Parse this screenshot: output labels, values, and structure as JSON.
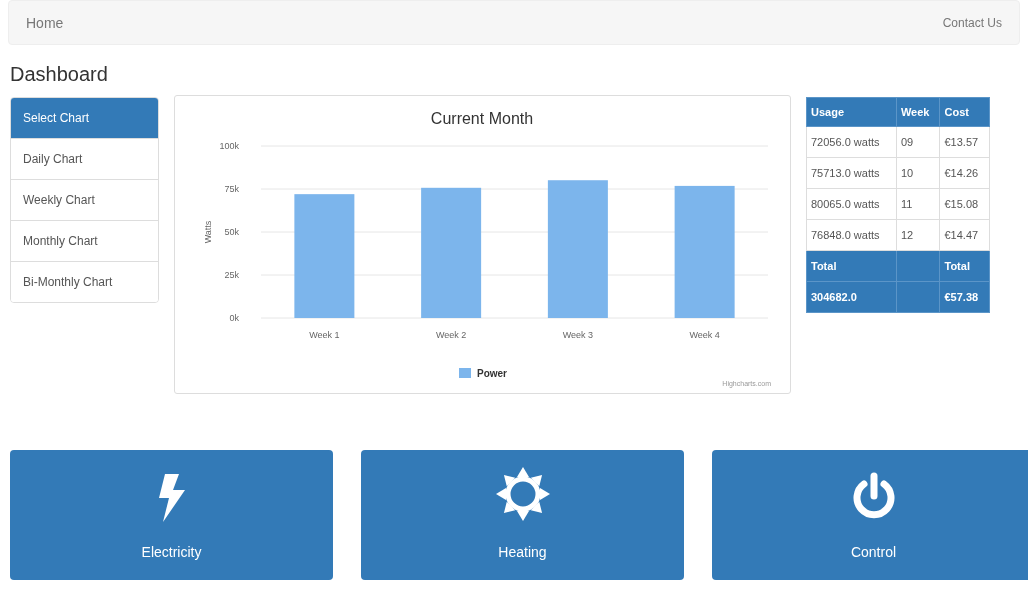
{
  "navbar": {
    "brand": "Home",
    "link": "Contact Us"
  },
  "page_title": "Dashboard",
  "sidebar": {
    "items": [
      {
        "label": "Select Chart",
        "selected": true
      },
      {
        "label": "Daily Chart",
        "selected": false
      },
      {
        "label": "Weekly Chart",
        "selected": false
      },
      {
        "label": "Monthly Chart",
        "selected": false
      },
      {
        "label": "Bi-Monthly Chart",
        "selected": false
      }
    ]
  },
  "chart": {
    "credits": "Highcharts.com",
    "chart_data": {
      "type": "bar",
      "title": "Current Month",
      "ylabel": "Watts",
      "categories": [
        "Week 1",
        "Week 2",
        "Week 3",
        "Week 4"
      ],
      "series": [
        {
          "name": "Power",
          "color": "#7cb5ec",
          "values": [
            72000,
            75700,
            80100,
            76800
          ]
        }
      ],
      "grid": true,
      "ylim": [
        0,
        100000
      ],
      "yticks": [
        {
          "value": 0,
          "label": "0k"
        },
        {
          "value": 25000,
          "label": "25k"
        },
        {
          "value": 50000,
          "label": "50k"
        },
        {
          "value": 75000,
          "label": "75k"
        },
        {
          "value": 100000,
          "label": "100k"
        }
      ]
    }
  },
  "table": {
    "columns": [
      "Usage",
      "Week",
      "Cost"
    ],
    "rows": [
      [
        "72056.0 watts",
        "09",
        "€13.57"
      ],
      [
        "75713.0 watts",
        "10",
        "€14.26"
      ],
      [
        "80065.0 watts",
        "11",
        "€15.08"
      ],
      [
        "76848.0 watts",
        "12",
        "€14.47"
      ]
    ],
    "totals": [
      {
        "usage": "Total",
        "cost": "Total"
      },
      {
        "usage": "304682.0",
        "cost": "€57.38"
      }
    ]
  },
  "tiles": [
    {
      "label": "Electricity",
      "kind": "bolt"
    },
    {
      "label": "Heating",
      "kind": "sun"
    },
    {
      "label": "Control",
      "kind": "power"
    }
  ]
}
